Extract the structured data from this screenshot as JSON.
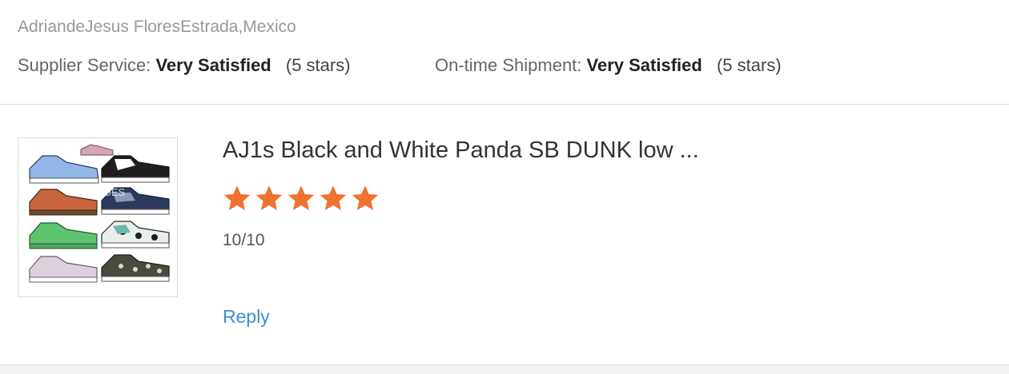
{
  "review": {
    "reviewer": "AdriandeJesus FloresEstrada,Mexico",
    "supplier_service": {
      "label": "Supplier Service:",
      "value": "Very Satisfied",
      "stars_text": "(5 stars)"
    },
    "on_time_shipment": {
      "label": "On-time Shipment:",
      "value": "Very Satisfied",
      "stars_text": "(5 stars)"
    },
    "product": {
      "title": "AJ1s Black and White Panda SB DUNK low ...",
      "thumbnail_watermark": "SB SHOES",
      "rating": 5,
      "rating_max": 5,
      "star_color": "#f07230"
    },
    "comment": "10/10",
    "reply_label": "Reply"
  }
}
